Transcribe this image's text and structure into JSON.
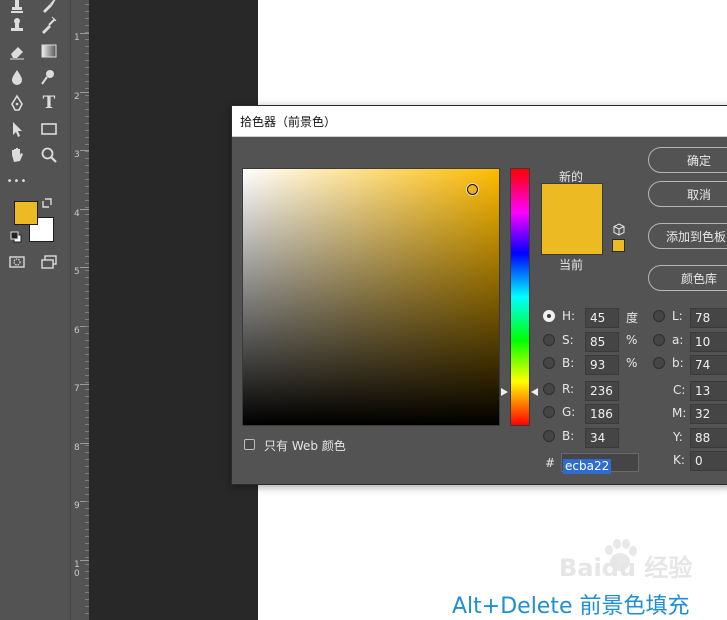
{
  "canvas_colors": {
    "workspace": "#282828",
    "toolbar": "#535353",
    "canvas": "#ffffff"
  },
  "toolbar": {
    "tools": [
      "stamp-icon",
      "history-brush-icon",
      "eraser-icon",
      "gradient-icon",
      "blur-icon",
      "dodge-icon",
      "pen-icon",
      "type-icon",
      "path-select-icon",
      "rectangle-icon",
      "hand-icon",
      "zoom-icon",
      "more-tools-icon",
      "swap-colors-icon",
      "default-colors-icon",
      "quick-mask-icon",
      "screen-mode-icon"
    ],
    "type_glyph": "T",
    "more_glyph": "•••",
    "foreground_color": "#ecba22",
    "background_color": "#ffffff"
  },
  "ruler": {
    "labels": [
      "1",
      "2",
      "3",
      "4",
      "5",
      "6",
      "7",
      "8",
      "9",
      "1\n0"
    ]
  },
  "dialog": {
    "title": "拾色器（前景色）",
    "new_label": "新的",
    "current_label": "当前",
    "new_color": "#ecba22",
    "current_color": "#ecba22",
    "buttons": {
      "ok": "确定",
      "cancel": "取消",
      "add_swatch": "添加到色板",
      "libraries": "颜色库"
    },
    "hsb": {
      "h": {
        "label": "H:",
        "value": "45",
        "unit": "度",
        "selected": true
      },
      "s": {
        "label": "S:",
        "value": "85",
        "unit": "%"
      },
      "b": {
        "label": "B:",
        "value": "93",
        "unit": "%"
      }
    },
    "rgb": {
      "r": {
        "label": "R:",
        "value": "236"
      },
      "g": {
        "label": "G:",
        "value": "186"
      },
      "b": {
        "label": "B:",
        "value": "34"
      }
    },
    "lab": {
      "l": {
        "label": "L:",
        "value": "78"
      },
      "a": {
        "label": "a:",
        "value": "10"
      },
      "b": {
        "label": "b:",
        "value": "74"
      }
    },
    "cmyk": {
      "c": {
        "label": "C:",
        "value": "13"
      },
      "m": {
        "label": "M:",
        "value": "32"
      },
      "y": {
        "label": "Y:",
        "value": "88"
      },
      "k": {
        "label": "K:",
        "value": "0"
      }
    },
    "hex_symbol": "#",
    "hex": "ecba22",
    "web_only_label": "只有 Web 颜色",
    "hue_color": "#ffbb00"
  },
  "caption": "Alt+Delete 前景色填充",
  "watermark": "Baidu 经验",
  "accent_colors": {
    "caption": "#1f8ed8",
    "selection": "#2f6ccf"
  }
}
